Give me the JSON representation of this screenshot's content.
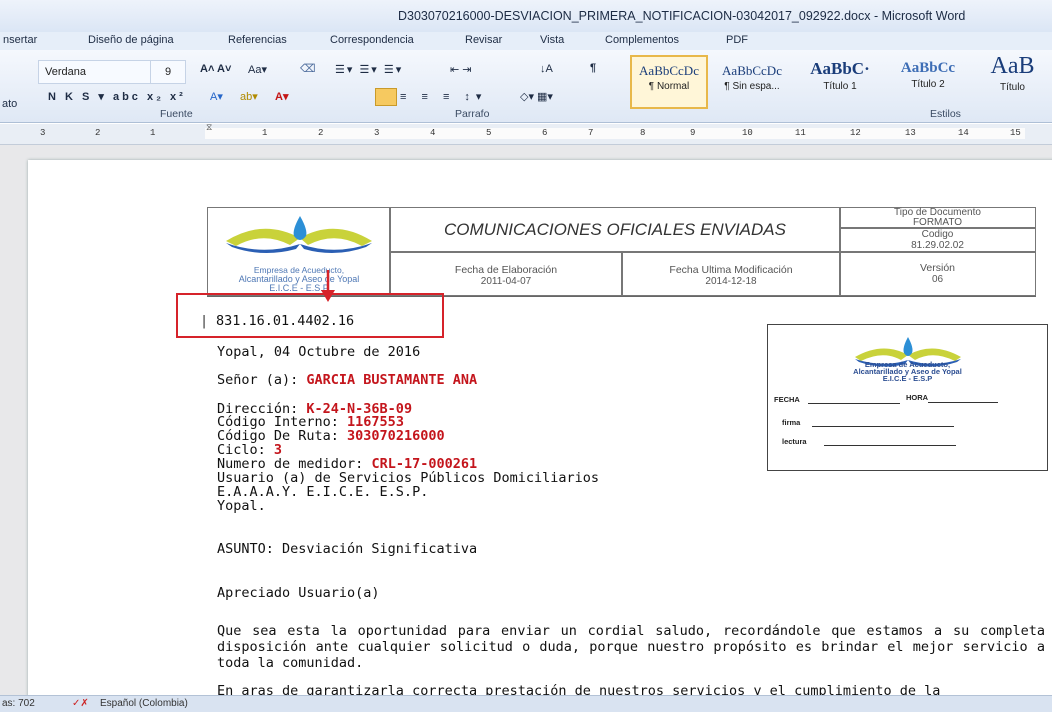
{
  "window": {
    "title": "D303070216000-DESVIACION_PRIMERA_NOTIFICACION-03042017_092922.docx - Microsoft Word"
  },
  "tabs": [
    "nsertar",
    "Diseño de página",
    "Referencias",
    "Correspondencia",
    "Revisar",
    "Vista",
    "Complementos",
    "PDF"
  ],
  "ribbon": {
    "font_name": "Verdana",
    "font_size": "9",
    "paste_partial": "ato",
    "group_fuente": "Fuente",
    "group_parrafo": "Parrafo",
    "group_estilos": "Estilos",
    "styles": [
      {
        "sample": "AaBbCcDc",
        "name": "¶ Normal"
      },
      {
        "sample": "AaBbCcDc",
        "name": "¶ Sin espa..."
      },
      {
        "sample": "AaBbC·",
        "name": "Título 1"
      },
      {
        "sample": "AaBbCc",
        "name": "Título 2"
      },
      {
        "sample": "AaB",
        "name": "Título"
      }
    ]
  },
  "ruler_numbers": [
    "3",
    "2",
    "1",
    "1",
    "2",
    "3",
    "4",
    "5",
    "6",
    "7",
    "8",
    "9",
    "10",
    "11",
    "12",
    "13",
    "14",
    "15"
  ],
  "header": {
    "company_line1": "Empresa de Acueducto,",
    "company_line2": "Alcantarillado y Aseo de Yopal",
    "company_line3": "E.I.C.E - E.S.P",
    "title": "COMUNICACIONES OFICIALES ENVIADAS",
    "tipo_label": "Tipo de Documento",
    "tipo_value": "FORMATO",
    "codigo_label": "Codigo",
    "codigo_value": "81.29.02.02",
    "elab_label": "Fecha de Elaboración",
    "elab_value": "2011-04-07",
    "mod_label": "Fecha Ultima Modificación",
    "mod_value": "2014-12-18",
    "version_label": "Versión",
    "version_value": "06"
  },
  "letter": {
    "ref": "831.16.01.4402.16",
    "date": "Yopal, 04  Octubre de 2016",
    "senor_label": "Señor (a): ",
    "senor_value": "GARCIA BUSTAMANTE ANA",
    "dir_label": "Dirección: ",
    "dir_value": "K-24-N-36B-09",
    "cod_int_label": "Código Interno: ",
    "cod_int_value": "1167553",
    "cod_ruta_label": "Código De Ruta: ",
    "cod_ruta_value": "303070216000",
    "ciclo_label": "Ciclo: ",
    "ciclo_value": "3",
    "medidor_label": "Numero de medidor: ",
    "medidor_value": "CRL-17-000261",
    "usuario": "Usuario (a) de Servicios Públicos Domiciliarios",
    "empresa": "E.A.A.A.Y.  E.I.C.E.  E.S.P.",
    "ciudad": "Yopal.",
    "asunto": "ASUNTO: Desviación Significativa",
    "saludo": "Apreciado Usuario(a)",
    "p1": "Que sea esta la oportunidad para enviar un cordial saludo, recordándole que estamos a su completa disposición ante cualquier solicitud o duda, porque nuestro propósito es brindar el mejor servicio a toda la comunidad.",
    "p2": "En aras de garantizarla correcta prestación de nuestros servicios y el cumplimiento de la"
  },
  "stamp": {
    "company_line1": "Empresa de Acueducto,",
    "company_line2": "Alcantarillado y Aseo de Yopal",
    "company_line3": "E.I.C.E - E.S.P",
    "fecha": "FECHA",
    "hora": "HORA",
    "firma": "firma",
    "lectura": "lectura"
  },
  "status": {
    "pages": "as: 702",
    "language": "Español (Colombia)"
  }
}
